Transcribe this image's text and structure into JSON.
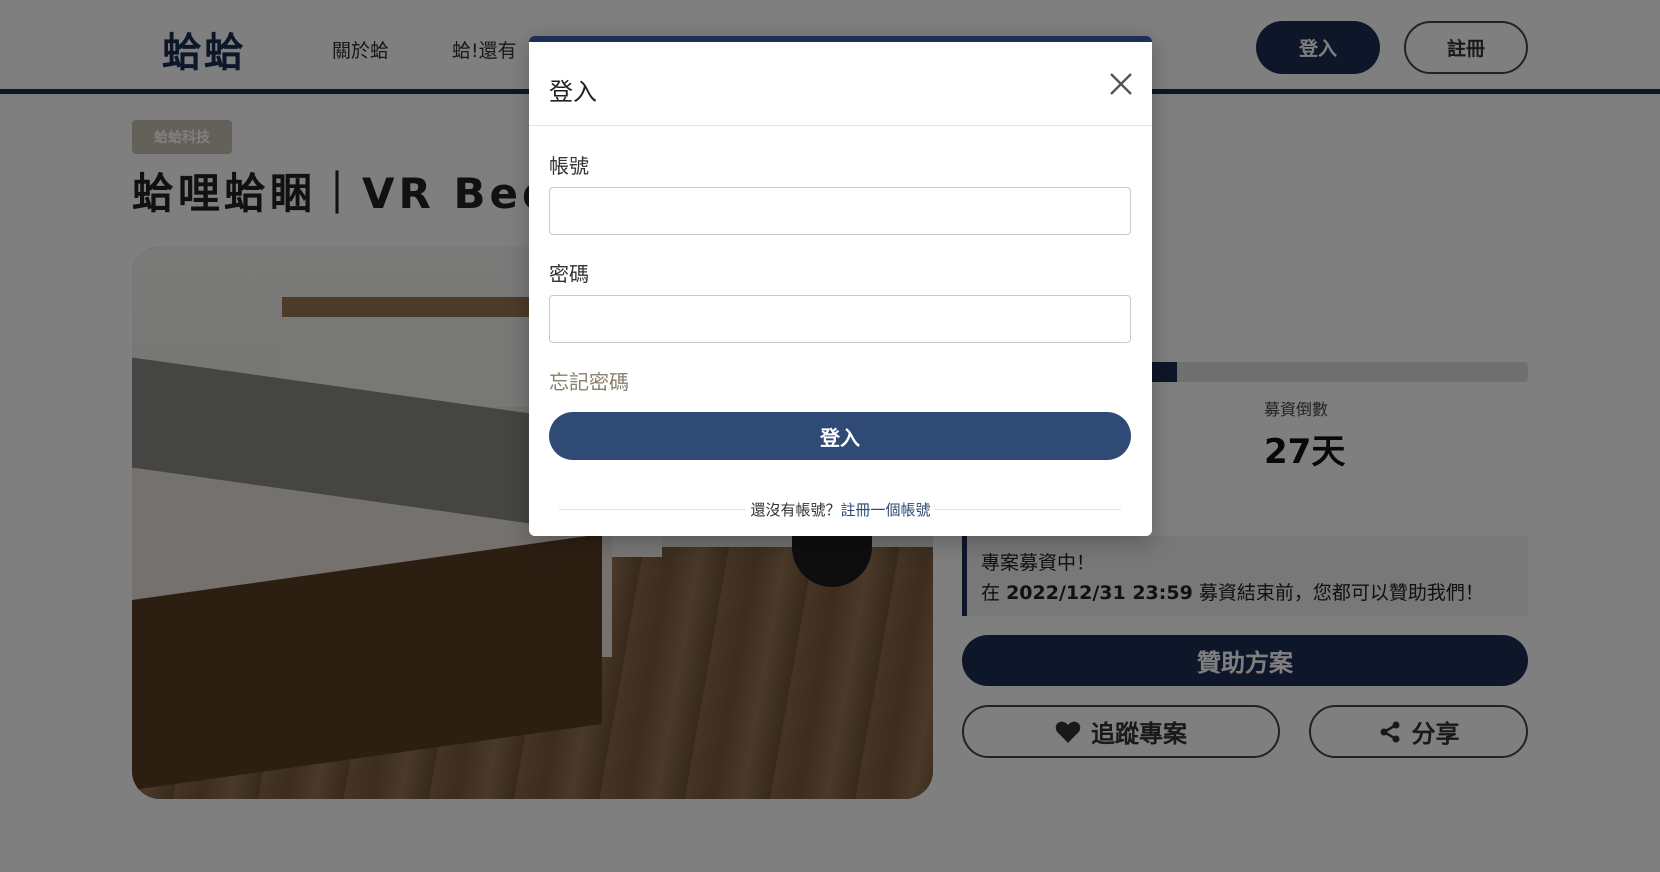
{
  "header": {
    "logo": "蛤蛤",
    "nav": {
      "about": "關於蛤",
      "more": "蛤!還有"
    },
    "login_label": "登入",
    "register_label": "註冊"
  },
  "project": {
    "company_badge": "蛤蛤科技",
    "title": "蛤哩蛤睏｜VR Bedr",
    "funding_progress": 0.38,
    "countdown_label": "募資倒數",
    "countdown_value": "27天",
    "notice_line1": "專案募資中！",
    "notice_line2_prefix": "在",
    "notice_deadline": "2022/12/31 23:59",
    "notice_line2_suffix": "募資結束前，您都可以贊助我們！",
    "sponsor_label": "贊助方案",
    "follow_label": "追蹤專案",
    "share_label": "分享"
  },
  "modal": {
    "title": "登入",
    "account_label": "帳號",
    "account_value": "",
    "password_label": "密碼",
    "password_value": "",
    "forgot_label": "忘記密碼",
    "login_button": "登入",
    "footer_question": "還沒有帳號？",
    "footer_link": "註冊一個帳號"
  },
  "colors": {
    "brand": "#1c2f55",
    "modal_button": "#2f4a75",
    "forgot": "#8a8070"
  }
}
